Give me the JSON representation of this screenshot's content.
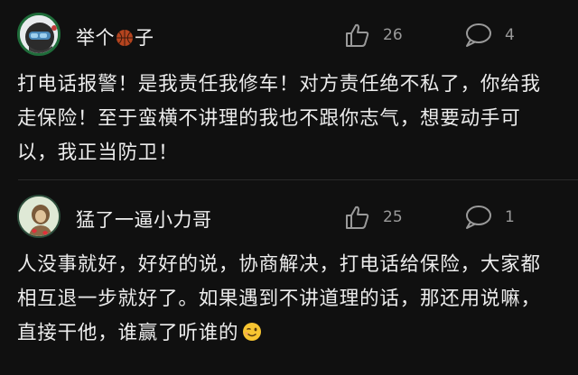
{
  "comments": [
    {
      "username_pre": "举个",
      "username_post": "子",
      "username_icon": "basketball-emoji",
      "likes": "26",
      "replies": "4",
      "text": "打电话报警！是我责任我修车！对方责任绝不私了，你给我走保险！至于蛮横不讲理的我也不跟你志气，想要动手可以，我正当防卫！"
    },
    {
      "username": "猛了一逼小力哥",
      "likes": "25",
      "replies": "1",
      "text": "人没事就好，好好的说，协商解决，打电话给保险，大家都相互退一步就好了。如果遇到不讲道理的话，那还用说嘛，直接干他，谁赢了听谁的",
      "trailing_icon": "winking-face-emoji"
    }
  ],
  "icons": {
    "like": "thumbs-up-icon",
    "reply": "speech-bubble-icon"
  },
  "colors": {
    "background": "#101010",
    "text": "#ececec",
    "muted": "#9a9a9a"
  }
}
